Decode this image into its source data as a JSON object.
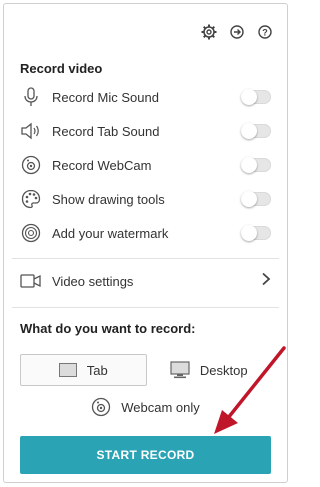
{
  "header": {
    "icons": [
      "gear-icon",
      "exit-icon",
      "help-icon"
    ]
  },
  "record_video": {
    "title": "Record video",
    "items": [
      {
        "label": "Record Mic Sound",
        "icon": "microphone-icon",
        "enabled": false
      },
      {
        "label": "Record Tab Sound",
        "icon": "speaker-icon",
        "enabled": false
      },
      {
        "label": "Record WebCam",
        "icon": "webcam-icon",
        "enabled": false
      },
      {
        "label": "Show drawing tools",
        "icon": "palette-icon",
        "enabled": false
      },
      {
        "label": "Add your watermark",
        "icon": "watermark-icon",
        "enabled": false
      }
    ]
  },
  "video_settings": {
    "label": "Video settings"
  },
  "record_target": {
    "title": "What do you want to record:",
    "options": [
      {
        "label": "Tab",
        "selected": true
      },
      {
        "label": "Desktop",
        "selected": false
      }
    ],
    "webcam_only": "Webcam only"
  },
  "start_button": {
    "label": "START RECORD",
    "color": "#2aa3b5"
  },
  "annotation": {
    "arrow_color": "#c0162a"
  }
}
